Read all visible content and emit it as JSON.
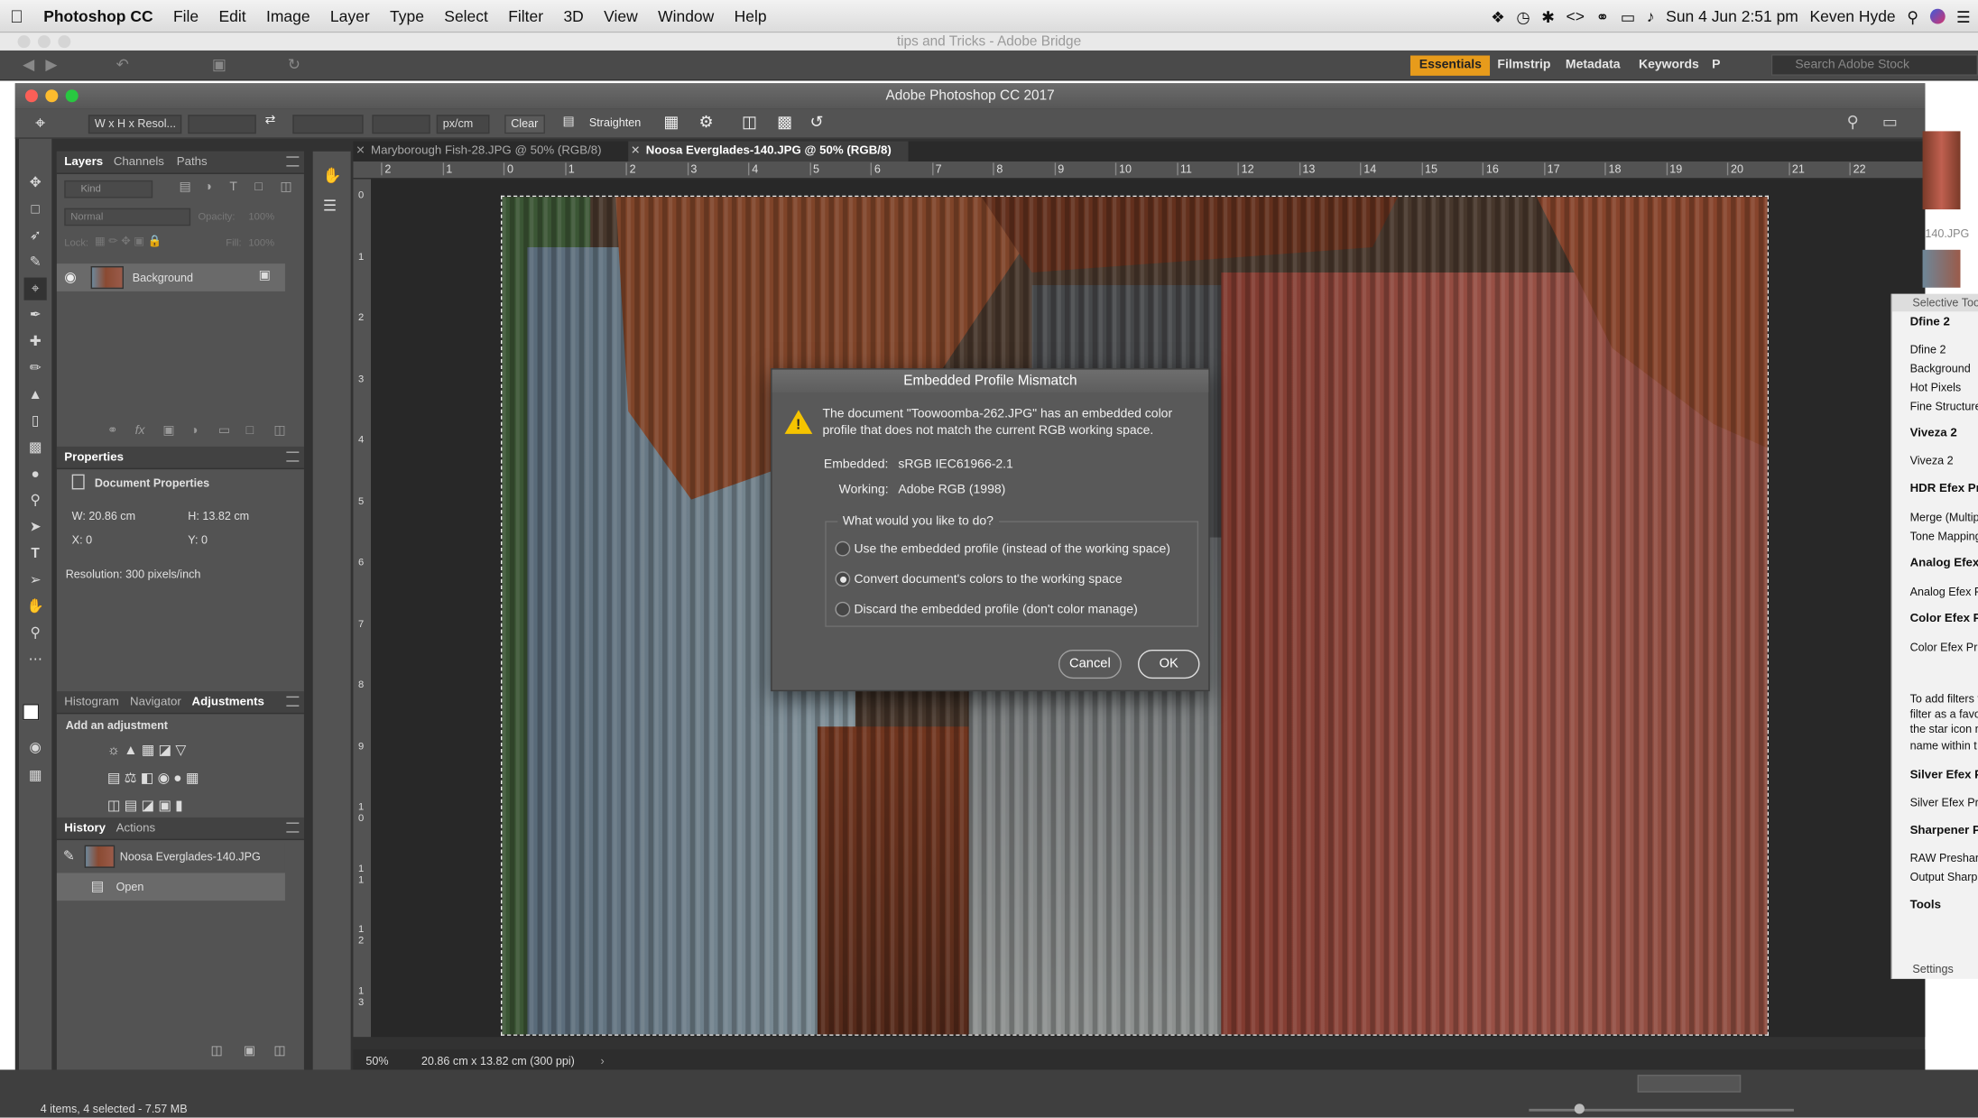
{
  "menubar": {
    "app": "Photoshop CC",
    "items": [
      "File",
      "Edit",
      "Image",
      "Layer",
      "Type",
      "Select",
      "Filter",
      "3D",
      "View",
      "Window",
      "Help"
    ],
    "clock": "Sun 4 Jun  2:51 pm",
    "user": "Keven Hyde"
  },
  "bridge": {
    "title": "tips and Tricks - Adobe Bridge",
    "workspaces": [
      "Essentials",
      "Filmstrip",
      "Metadata",
      "Keywords",
      "P"
    ],
    "search_placeholder": "Search Adobe Stock",
    "status": "4 items, 4 selected - 7.57 MB"
  },
  "ps": {
    "title": "Adobe Photoshop CC 2017",
    "options": {
      "ratio": "W x H x Resol...",
      "unit": "px/cm",
      "clear": "Clear",
      "straighten": "Straighten"
    },
    "tabs": [
      {
        "label": "Maryborough Fish-28.JPG @ 50% (RGB/8)"
      },
      {
        "label": "Noosa Everglades-140.JPG @ 50% (RGB/8)"
      }
    ],
    "layers": {
      "tabs": [
        "Layers",
        "Channels",
        "Paths"
      ],
      "kind": "Kind",
      "blend": "Normal",
      "opacity_label": "Opacity:",
      "opacity": "100%",
      "lock_label": "Lock:",
      "fill_label": "Fill:",
      "fill": "100%",
      "layer": "Background"
    },
    "properties": {
      "tab": "Properties",
      "header": "Document Properties",
      "w": "W:  20.86 cm",
      "h": "H:  13.82 cm",
      "x": "X:  0",
      "y": "Y:  0",
      "resolution": "Resolution: 300 pixels/inch"
    },
    "adjust": {
      "tabs": [
        "Histogram",
        "Navigator",
        "Adjustments"
      ],
      "add": "Add an adjustment"
    },
    "history": {
      "tabs": [
        "History",
        "Actions"
      ],
      "snapshot": "Noosa Everglades-140.JPG",
      "step": "Open"
    },
    "status": {
      "zoom": "50%",
      "doc": "20.86 cm x 13.82 cm (300 ppi)"
    },
    "ruler": [
      "2",
      "1",
      "0",
      "1",
      "2",
      "3",
      "4",
      "5",
      "6",
      "7",
      "8",
      "9",
      "10",
      "11",
      "12",
      "13",
      "14",
      "15",
      "16",
      "17",
      "18",
      "19",
      "20",
      "21",
      "22"
    ],
    "vruler": [
      "0",
      "1",
      "2",
      "3",
      "4",
      "5",
      "6",
      "7",
      "8",
      "9",
      "1\n0",
      "1\n1",
      "1\n2",
      "1\n3"
    ]
  },
  "dialog": {
    "title": "Embedded Profile Mismatch",
    "msg1": "The document \"Toowoomba-262.JPG\" has an embedded color",
    "msg2": "profile that does not match the current RGB working space.",
    "embedded_label": "Embedded:",
    "embedded": "sRGB IEC61966-2.1",
    "working_label": "Working:",
    "working": "Adobe RGB (1998)",
    "question": "What would you like to do?",
    "options": [
      "Use the embedded profile (instead of the working space)",
      "Convert document's colors to the working space",
      "Discard the embedded profile (don't color manage)"
    ],
    "selected": 1,
    "cancel": "Cancel",
    "ok": "OK"
  },
  "nik": {
    "title": "Selective Too",
    "sections": [
      {
        "h": "Dfine 2",
        "items": [
          "Dfine 2",
          "Background",
          "Hot Pixels",
          "Fine Structure"
        ]
      },
      {
        "h": "Viveza 2",
        "items": [
          "Viveza 2"
        ]
      },
      {
        "h": "HDR Efex Pr",
        "items": [
          "Merge (Multip",
          "Tone Mapping"
        ]
      },
      {
        "h": "Analog Efex",
        "items": [
          "Analog Efex P"
        ]
      },
      {
        "h": "Color Efex P",
        "items": [
          "Color Efex Pr"
        ]
      }
    ],
    "note": [
      "To add filters t",
      "filter as a favo",
      "the star icon n",
      "name within t"
    ],
    "sections2": [
      {
        "h": "Silver Efex P",
        "items": [
          "Silver Efex Pr"
        ]
      },
      {
        "h": "Sharpener P",
        "items": [
          "RAW Preshar",
          "Output Sharp"
        ]
      }
    ],
    "tools": "Tools",
    "settings": "Settings",
    "thumb_label": "140.JPG"
  }
}
